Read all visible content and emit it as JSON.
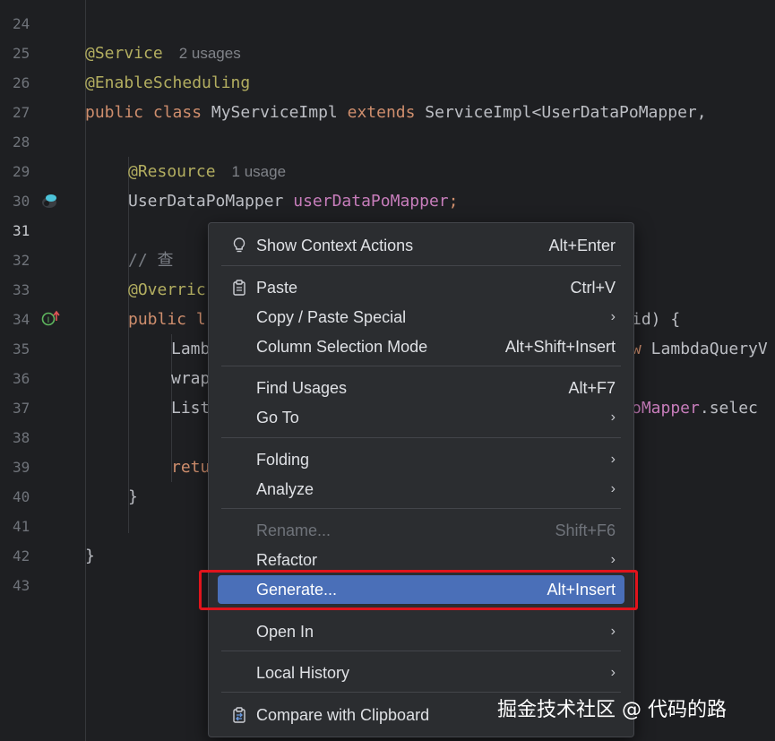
{
  "gutter": {
    "line_numbers": [
      "24",
      "25",
      "26",
      "27",
      "28",
      "29",
      "30",
      "31",
      "32",
      "33",
      "34",
      "35",
      "36",
      "37",
      "38",
      "39",
      "40",
      "41",
      "42",
      "43"
    ],
    "current_line": "31"
  },
  "code": {
    "l25_annotation": "@Service",
    "l25_hint": "2 usages",
    "l26_annotation": "@EnableScheduling",
    "l27_kw1": "public class",
    "l27_name": " MyServiceImpl ",
    "l27_kw2": "extends",
    "l27_rest": " ServiceImpl<UserDataPoMapper,",
    "l29_annotation": "@Resource",
    "l29_hint": "1 usage",
    "l30_type": "UserDataPoMapper ",
    "l30_field": "userDataPoMapper",
    "l30_semi": ";",
    "l32_comment": "// 查",
    "l33_annotation": "@Overric",
    "l34_kw": "public l",
    "l34_tail": "id) {",
    "l35_head": "Lamb",
    "l35_kw": "w",
    "l35_tail": " LambdaQueryV",
    "l36_head": "wrap",
    "l37_head": "List",
    "l37_field": "oMapper",
    "l37_tail": ".selec",
    "l39_kw": "retu",
    "l40_brace": "}",
    "l42_brace": "}"
  },
  "menu": {
    "show_context_actions": {
      "label": "Show Context Actions",
      "shortcut": "Alt+Enter",
      "icon": "lightbulb-icon"
    },
    "paste": {
      "label": "Paste",
      "shortcut": "Ctrl+V",
      "icon": "clipboard-icon"
    },
    "copy_paste_special": {
      "label": "Copy / Paste Special"
    },
    "column_selection_mode": {
      "label": "Column Selection Mode",
      "shortcut": "Alt+Shift+Insert"
    },
    "find_usages": {
      "label": "Find Usages",
      "shortcut": "Alt+F7"
    },
    "go_to": {
      "label": "Go To"
    },
    "folding": {
      "label": "Folding"
    },
    "analyze": {
      "label": "Analyze"
    },
    "rename": {
      "label": "Rename...",
      "shortcut": "Shift+F6"
    },
    "refactor": {
      "label": "Refactor"
    },
    "generate": {
      "label": "Generate...",
      "shortcut": "Alt+Insert"
    },
    "open_in": {
      "label": "Open In"
    },
    "local_history": {
      "label": "Local History"
    },
    "compare_clipboard": {
      "label": "Compare with Clipboard",
      "icon": "compare-clipboard-icon"
    },
    "submenu_arrow": "›"
  },
  "watermark": "掘金技术社区 @ 代码的路",
  "colors": {
    "background": "#1e1f22",
    "menu_bg": "#2b2d30",
    "selected": "#4a6fb8",
    "annotation": "#b3ae60",
    "keyword": "#cf8e6d",
    "field": "#c77dbb",
    "highlight_border": "#e0141c"
  }
}
